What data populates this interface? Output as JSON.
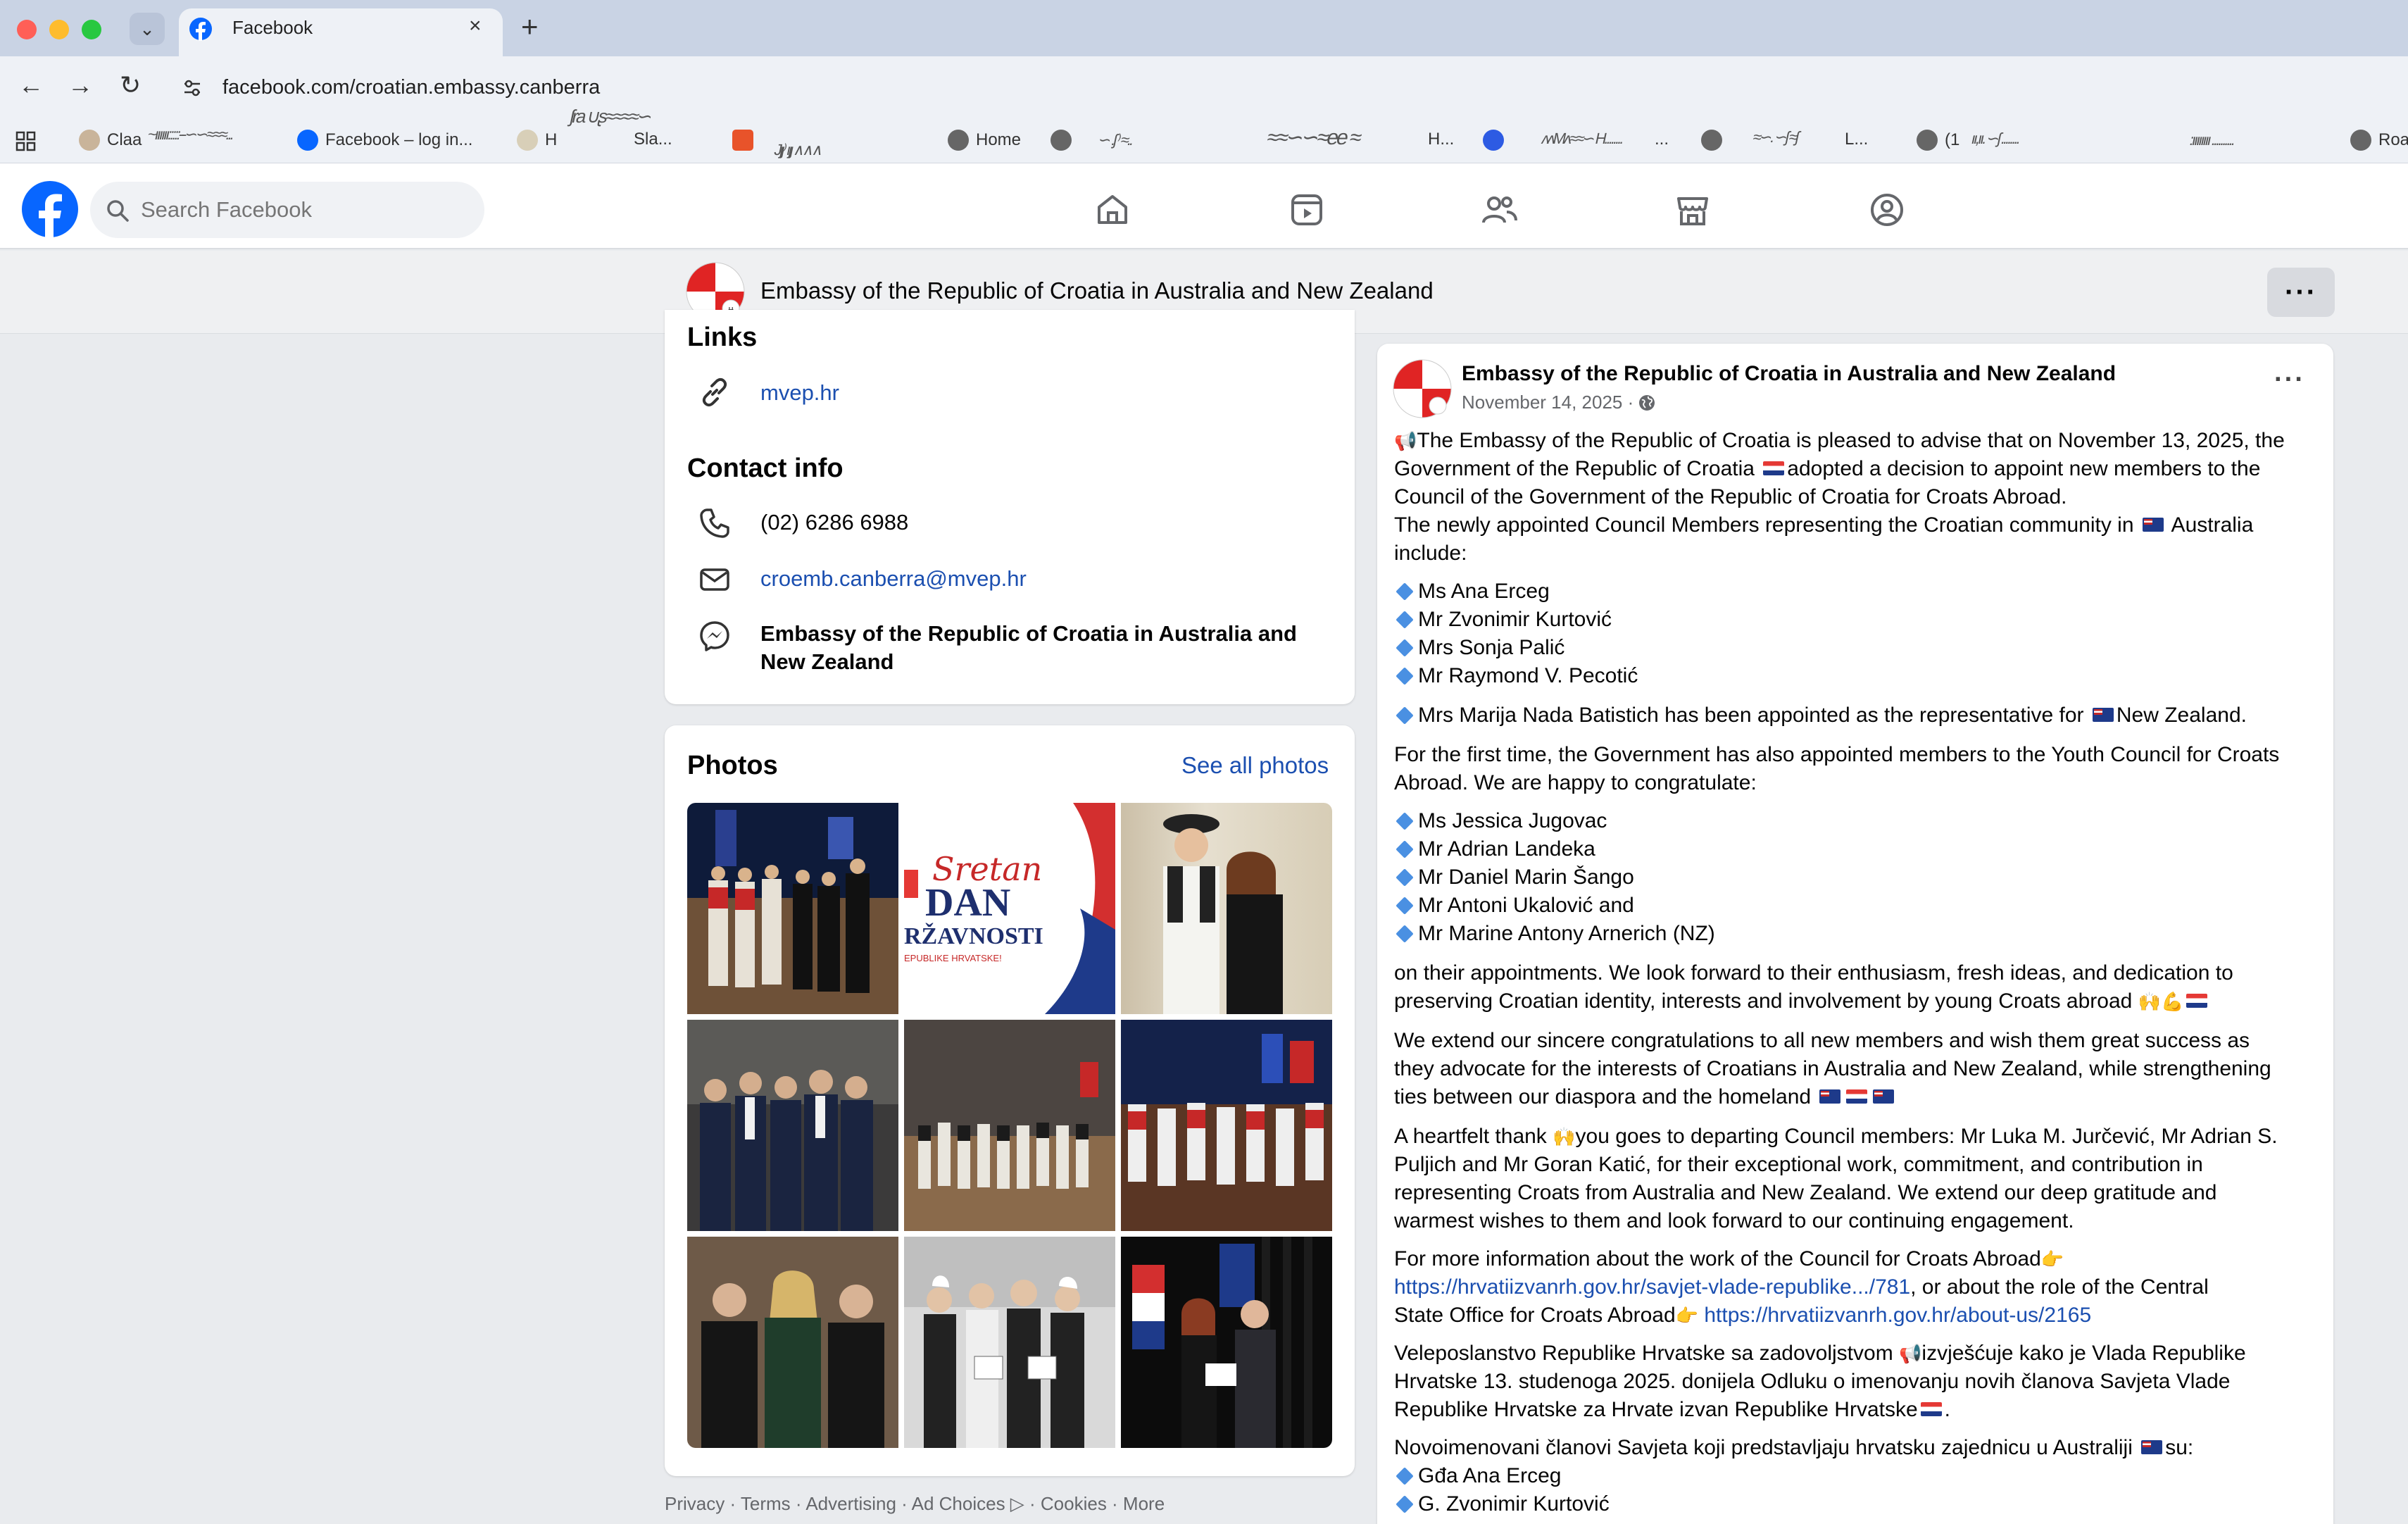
{
  "browser": {
    "tab_title": "Facebook",
    "url": "facebook.com/croatian.embassy.canberra",
    "bookmarks": [
      "Claa",
      "Facebook – log in...",
      "H",
      "Sla...",
      "Home",
      "H...",
      "...",
      "L...",
      "(1",
      "Roa"
    ]
  },
  "facebook": {
    "search_placeholder": "Search Facebook",
    "nav_icons": [
      "home-icon",
      "video-icon",
      "friends-icon",
      "marketplace-icon",
      "gaming-icon"
    ]
  },
  "page": {
    "name": "Embassy of the Republic of Croatia in Australia and New Zealand",
    "more_label": "···"
  },
  "about": {
    "links_heading": "Links",
    "website": "mvep.hr",
    "contact_heading": "Contact info",
    "phone": "(02) 6286 6988",
    "email": "croemb.canberra@mvep.hr",
    "messenger_line1": "Embassy of the Republic of Croatia in Australia and",
    "messenger_line2": "New Zealand"
  },
  "photos": {
    "heading": "Photos",
    "see_all": "See all photos",
    "banner_script": "Sretan",
    "banner_big1": "DAN",
    "banner_big2": "RŽAVNOSTI",
    "banner_small": "EPUBLIKE HRVATSKE!"
  },
  "footer": {
    "items": [
      "Privacy",
      "Terms",
      "Advertising",
      "Ad Choices",
      "Cookies",
      "More"
    ],
    "text": "Privacy · Terms · Advertising · Ad Choices ▷ · Cookies · More"
  },
  "post": {
    "author": "Embassy of the Republic of Croatia in Australia and New Zealand",
    "date": "November 14, 2025 ·",
    "menu": "···",
    "p1_a": "The Embassy of the Republic of Croatia is pleased to advise that on November 13, 2025, the",
    "p1_b1": "Government of the Republic of Croatia ",
    "p1_b2": "adopted a decision to appoint new members to the",
    "p1_c": "Council of the Government of the Republic of Croatia for Croats Abroad.",
    "p2_a1": "The newly appointed Council Members representing the Croatian community in ",
    "p2_a2": " Australia",
    "p2_b": "include:",
    "council": [
      "Ms Ana Erceg",
      "Mr Zvonimir Kurtović",
      "Mrs Sonja Palić",
      "Mr Raymond V. Pecotić"
    ],
    "nz_rep_a": "Mrs Marija Nada Batistich has been appointed as the representative for ",
    "nz_rep_b": "New Zealand.",
    "youth_a": "For the first time, the Government has also appointed members to the Youth Council for Croats",
    "youth_b": "Abroad. We are happy to congratulate:",
    "youth": [
      "Ms Jessica Jugovac",
      "Mr Adrian Landeka",
      "Mr Daniel Marin Šango",
      "Mr Antoni Ukalović and",
      "Mr Marine Antony Arnerich (NZ)"
    ],
    "appt_a": "on their appointments. We look forward to their enthusiasm, fresh ideas, and dedication to",
    "appt_b": "preserving Croatian identity, interests and involvement by young Croats abroad ",
    "ext_a": "We extend our sincere congratulations to all new members and wish them great success as",
    "ext_b": "they advocate for the interests of Croatians in Australia and New Zealand, while strengthening",
    "ext_c": "ties between our diaspora and the homeland ",
    "thank_a1": "A heartfelt thank ",
    "thank_a2": "you goes to departing Council members: Mr Luka M. Jurčević, Mr Adrian S.",
    "thank_b": "Puljich and Mr Goran Katić, for their exceptional work, commitment, and contribution in",
    "thank_c": "representing Croats from Australia and New Zealand. We extend our deep gratitude and",
    "thank_d": "warmest wishes to them and look forward to our continuing engagement.",
    "info_a": "For more information about the work of the Council for Croats Abroad",
    "link1": "https://hrvatiizvanrh.gov.hr/savjet-vlade-republike.../781",
    "info_b": ", or about the role of the Central",
    "info_c": "State Office for Croats Abroad",
    "link2": "https://hrvatiizvanrh.gov.hr/about-us/2165",
    "hr_a1": "Veleposlanstvo Republike Hrvatske sa zadovoljstvom ",
    "hr_a2": "izvješćuje kako je Vlada Republike",
    "hr_b": "Hrvatske 13. studenoga 2025. donijela Odluku o imenovanju novih članova Savjeta Vlade",
    "hr_c": "Republike Hrvatske za Hrvate izvan Republike Hrvatske",
    "hr_d1": "Novoimenovani članovi Savjeta koji predstavljaju hrvatsku zajednicu u Australiji ",
    "hr_d2": "su:",
    "hr_list": [
      "Gđa Ana Erceg",
      "G. Zvonimir Kurtović"
    ]
  },
  "colors": {
    "fb_blue": "#0866ff",
    "link": "#1b4fb0",
    "bg": "#e9ebee"
  }
}
